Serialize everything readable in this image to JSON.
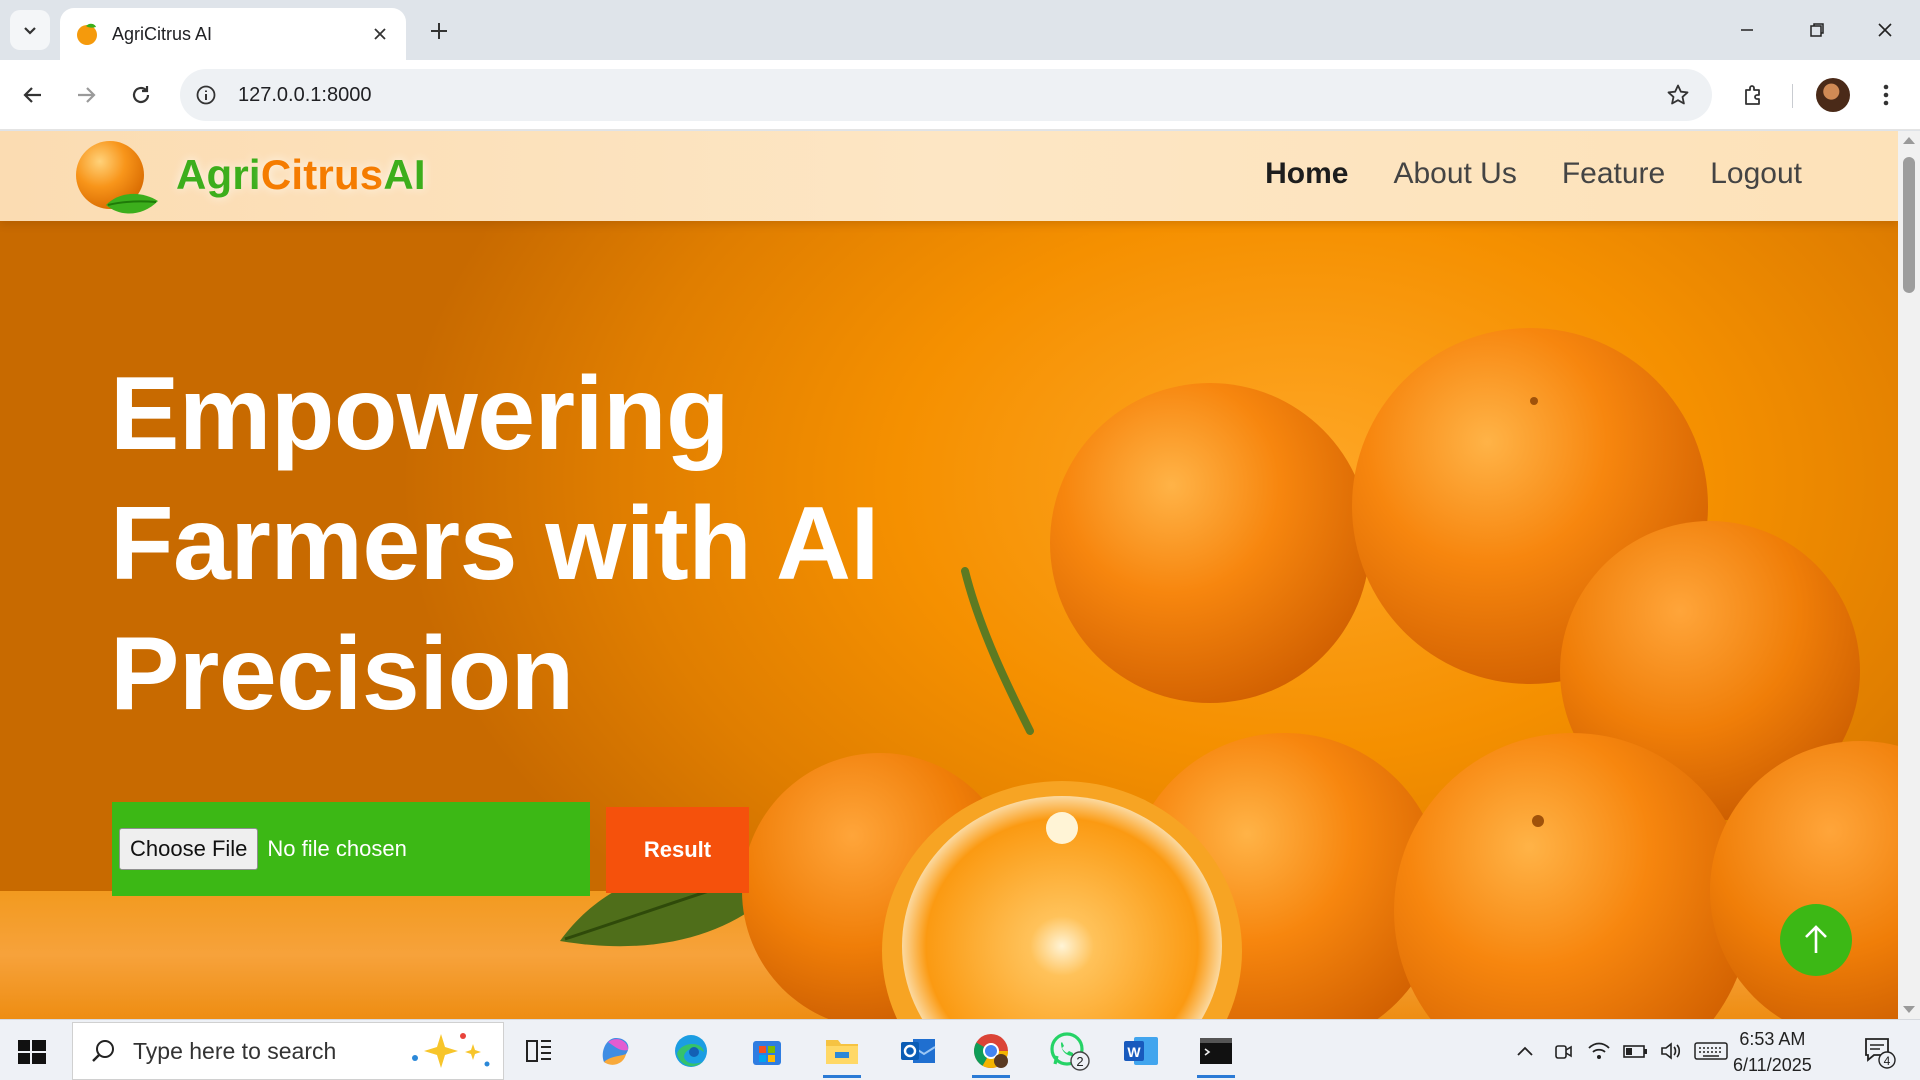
{
  "browser": {
    "tab_title": "AgriCitrus AI",
    "url": "127.0.0.1:8000"
  },
  "site": {
    "brand_agri": "Agri",
    "brand_citrus": "Citrus",
    "brand_ai": "AI",
    "nav": [
      {
        "label": "Home",
        "active": true
      },
      {
        "label": "About Us",
        "active": false
      },
      {
        "label": "Feature",
        "active": false
      },
      {
        "label": "Logout",
        "active": false
      }
    ],
    "headline_lines": [
      "Empowering",
      "Farmers with AI",
      "Precision"
    ],
    "choose_file_label": "Choose File",
    "file_status": "No file chosen",
    "result_label": "Result",
    "colors": {
      "brand_green": "#3cb815",
      "brand_orange": "#f57c00",
      "result_orange": "#f5510c"
    }
  },
  "taskbar": {
    "search_placeholder": "Type here to search",
    "whatsapp_badge": "2",
    "notification_count": "4",
    "time": "6:53 AM",
    "date": "6/11/2025",
    "apps": [
      "task-view-icon",
      "copilot-icon",
      "edge-icon",
      "store-icon",
      "file-explorer-icon",
      "outlook-icon",
      "chrome-icon",
      "whatsapp-icon",
      "word-icon",
      "terminal-icon"
    ]
  }
}
